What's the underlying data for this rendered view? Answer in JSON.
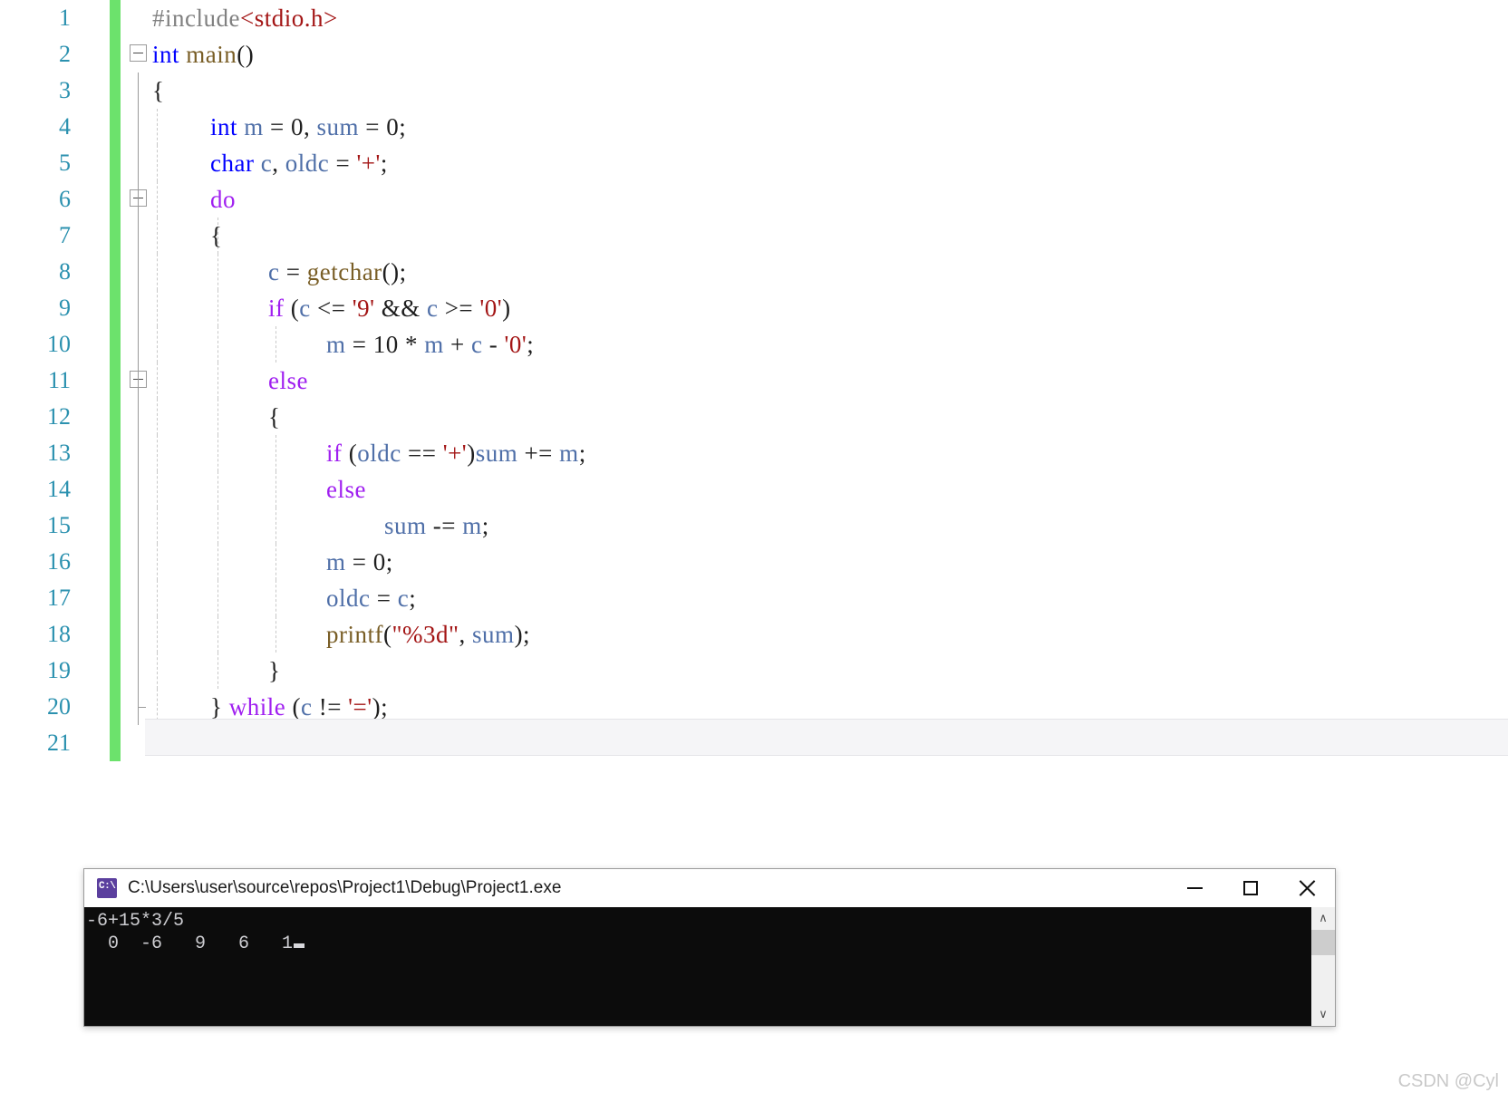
{
  "editor": {
    "language": "C",
    "gutter_color": "#2b91af",
    "change_bar_color": "#6ce26c",
    "current_line": 21,
    "lines": [
      {
        "num": "1",
        "indent": 0,
        "fold": "none",
        "text": "#include<stdio.h>"
      },
      {
        "num": "2",
        "indent": 0,
        "fold": "collapse",
        "text": "int main()"
      },
      {
        "num": "3",
        "indent": 0,
        "fold": "none",
        "text": "{"
      },
      {
        "num": "4",
        "indent": 1,
        "fold": "none",
        "text": "int m = 0, sum = 0;"
      },
      {
        "num": "5",
        "indent": 1,
        "fold": "none",
        "text": "char c, oldc = '+';"
      },
      {
        "num": "6",
        "indent": 1,
        "fold": "collapse",
        "text": "do"
      },
      {
        "num": "7",
        "indent": 1,
        "fold": "none",
        "text": "{"
      },
      {
        "num": "8",
        "indent": 2,
        "fold": "none",
        "text": "c = getchar();"
      },
      {
        "num": "9",
        "indent": 2,
        "fold": "none",
        "text": "if (c <= '9' && c >= '0')"
      },
      {
        "num": "10",
        "indent": 3,
        "fold": "none",
        "text": "m = 10 * m + c - '0';"
      },
      {
        "num": "11",
        "indent": 2,
        "fold": "collapse",
        "text": "else"
      },
      {
        "num": "12",
        "indent": 2,
        "fold": "none",
        "text": "{"
      },
      {
        "num": "13",
        "indent": 3,
        "fold": "none",
        "text": "if (oldc == '+')sum += m;"
      },
      {
        "num": "14",
        "indent": 3,
        "fold": "none",
        "text": "else"
      },
      {
        "num": "15",
        "indent": 4,
        "fold": "none",
        "text": "sum -= m;"
      },
      {
        "num": "16",
        "indent": 3,
        "fold": "none",
        "text": "m = 0;"
      },
      {
        "num": "17",
        "indent": 3,
        "fold": "none",
        "text": "oldc = c;"
      },
      {
        "num": "18",
        "indent": 3,
        "fold": "none",
        "text": "printf(\"%3d\", sum);"
      },
      {
        "num": "19",
        "indent": 2,
        "fold": "none",
        "text": "}"
      },
      {
        "num": "20",
        "indent": 1,
        "fold": "end",
        "text": "} while (c != '=');"
      },
      {
        "num": "21",
        "indent": 0,
        "fold": "none",
        "text": "}"
      }
    ]
  },
  "console": {
    "title": "C:\\Users\\user\\source\\repos\\Project1\\Debug\\Project1.exe",
    "icon_label": "C:\\",
    "window_buttons": {
      "minimize": "—",
      "maximize": "□",
      "close": "✕"
    },
    "output_lines": [
      "-6+15*3/5",
      "  0  -6   9   6   1"
    ],
    "background": "#0c0c0c",
    "foreground": "#ccccd0",
    "scrollbar": {
      "up_arrow": "∧",
      "down_arrow": "∨"
    }
  },
  "watermark": {
    "text": "CSDN @Cyl"
  }
}
